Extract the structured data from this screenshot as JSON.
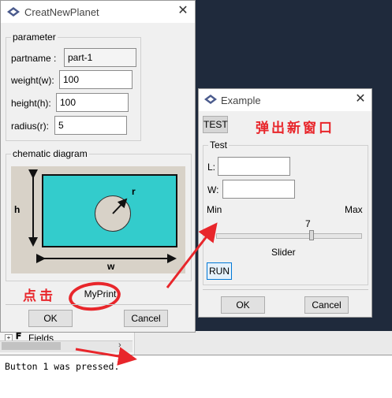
{
  "planet_dialog": {
    "title": "CreatNewPlanet",
    "parameter_group": "parameter",
    "fields": [
      {
        "label": "partname :",
        "value": "part-1"
      },
      {
        "label": "weight(w):",
        "value": "100"
      },
      {
        "label": "height(h):",
        "value": "100"
      },
      {
        "label": "radius(r):",
        "value": "5"
      }
    ],
    "diagram_group": "chematic diagram",
    "diagram": {
      "h": "h",
      "w": "w",
      "r": "r"
    },
    "myprint_label": "MyPrint",
    "ok_label": "OK",
    "cancel_label": "Cancel"
  },
  "example_dialog": {
    "title": "Example",
    "test_button": "TEST",
    "test_group": "Test",
    "l_label": "L:",
    "l_value": "",
    "w_label": "W:",
    "w_value": "",
    "min_label": "Min",
    "max_label": "Max",
    "slider_value": "7",
    "slider_label": "Slider",
    "run_button": "RUN",
    "ok_label": "OK",
    "cancel_label": "Cancel"
  },
  "annotations": {
    "new_window": "弹出新窗口",
    "click": "点击"
  },
  "tree": {
    "fields_label": "Fields"
  },
  "console": {
    "message": "Button 1 was pressed."
  },
  "colors": {
    "diagram_fill": "#33cccc",
    "diagram_bg": "#d8d2c8",
    "annotation_red": "#e8262b",
    "desktop_bg": "#1f2a3c"
  }
}
